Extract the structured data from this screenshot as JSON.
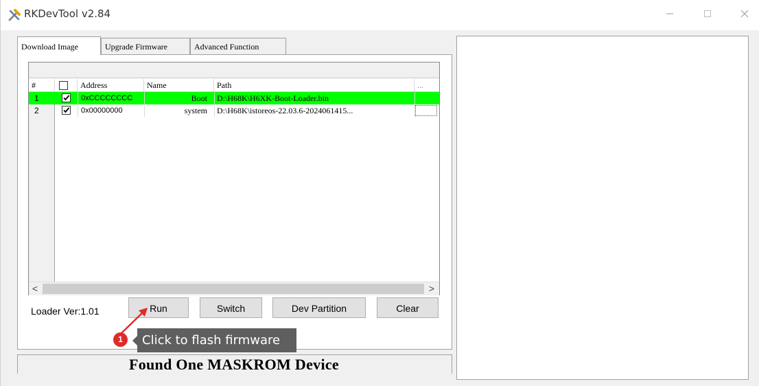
{
  "window": {
    "title": "RKDevTool v2.84"
  },
  "tabs": [
    {
      "label": "Download Image",
      "active": true
    },
    {
      "label": "Upgrade Firmware",
      "active": false
    },
    {
      "label": "Advanced Function",
      "active": false
    }
  ],
  "table": {
    "headers": [
      "#",
      "",
      "Address",
      "Name",
      "Path",
      "..."
    ],
    "rows": [
      {
        "index": "1",
        "checked": true,
        "address": "0xCCCCCCCC",
        "name": "Boot",
        "path": "D:\\H68K\\H6XK-Boot-Loader.bin",
        "selected": true
      },
      {
        "index": "2",
        "checked": true,
        "address": "0x00000000",
        "name": "system",
        "path": "D:\\H68K\\istoreos-22.03.6-2024061415...",
        "selected": false
      }
    ]
  },
  "scrollbar": {
    "left_arrow": "<",
    "right_arrow": ">"
  },
  "loader": {
    "version_label": "Loader Ver:1.01"
  },
  "buttons": {
    "run": "Run",
    "switch": "Switch",
    "dev_partition": "Dev Partition",
    "clear": "Clear"
  },
  "annotation": {
    "badge": "1",
    "text": "Click to flash firmware",
    "color": "#e02b2b"
  },
  "status": {
    "text": "Found One MASKROM Device"
  },
  "colors": {
    "selected_row": "#00ff00",
    "accent_red": "#e02b2b"
  }
}
